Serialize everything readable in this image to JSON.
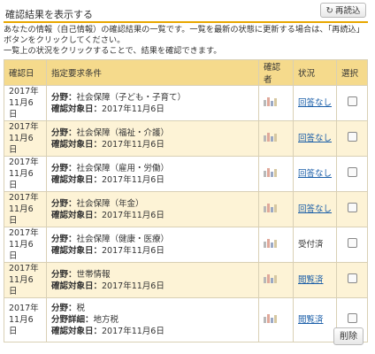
{
  "header": {
    "title": "確認結果を表示する",
    "reload_label": "再読込"
  },
  "description": {
    "line1": "あなたの情報（自己情報）の確認結果の一覧です。一覧を最新の状態に更新する場合は、「再読込」",
    "line2": "ボタンをクリックしてください。",
    "line3": "一覧上の状況をクリックすることで、結果を確認できます。"
  },
  "table": {
    "headers": [
      "確認日",
      "指定要求条件",
      "確認者",
      "状況",
      "選択"
    ],
    "rows": [
      {
        "date_year": "2017年",
        "date_day": "11月6日",
        "field_label": "分野：",
        "field_value": "社会保障（子ども・子育て）",
        "target_label": "確認対象日：",
        "target_value": "2017年11月6日",
        "detail_label": "",
        "detail_value": "",
        "status": "回答なし",
        "status_link": true
      },
      {
        "date_year": "2017年",
        "date_day": "11月6日",
        "field_label": "分野：",
        "field_value": "社会保障（福祉・介護）",
        "target_label": "確認対象日：",
        "target_value": "2017年11月6日",
        "detail_label": "",
        "detail_value": "",
        "status": "回答なし",
        "status_link": true
      },
      {
        "date_year": "2017年",
        "date_day": "11月6日",
        "field_label": "分野：",
        "field_value": "社会保障（雇用・労働）",
        "target_label": "確認対象日：",
        "target_value": "2017年11月6日",
        "detail_label": "",
        "detail_value": "",
        "status": "回答なし",
        "status_link": true
      },
      {
        "date_year": "2017年",
        "date_day": "11月6日",
        "field_label": "分野：",
        "field_value": "社会保障（年金）",
        "target_label": "確認対象日：",
        "target_value": "2017年11月6日",
        "detail_label": "",
        "detail_value": "",
        "status": "回答なし",
        "status_link": true
      },
      {
        "date_year": "2017年",
        "date_day": "11月6日",
        "field_label": "分野：",
        "field_value": "社会保障（健康・医療）",
        "target_label": "確認対象日：",
        "target_value": "2017年11月6日",
        "detail_label": "",
        "detail_value": "",
        "status": "受付済",
        "status_link": false
      },
      {
        "date_year": "2017年",
        "date_day": "11月6日",
        "field_label": "分野：",
        "field_value": "世帯情報",
        "target_label": "確認対象日：",
        "target_value": "2017年11月6日",
        "detail_label": "",
        "detail_value": "",
        "status": "閲覧済",
        "status_link": true
      },
      {
        "date_year": "2017年",
        "date_day": "11月6日",
        "field_label": "分野：",
        "field_value": "税",
        "target_label": "確認対象日：",
        "target_value": "2017年11月6日",
        "detail_label": "分野詳細：",
        "detail_value": "地方税",
        "status": "閲覧済",
        "status_link": true
      }
    ]
  },
  "footer": {
    "delete_label": "削除"
  },
  "colors": {
    "accent": "#e8a700",
    "header_bg": "#f5da8c",
    "even_row_bg": "#fdf3d6",
    "link": "#1a5ea8"
  },
  "icons": {
    "reload": "refresh-icon"
  }
}
